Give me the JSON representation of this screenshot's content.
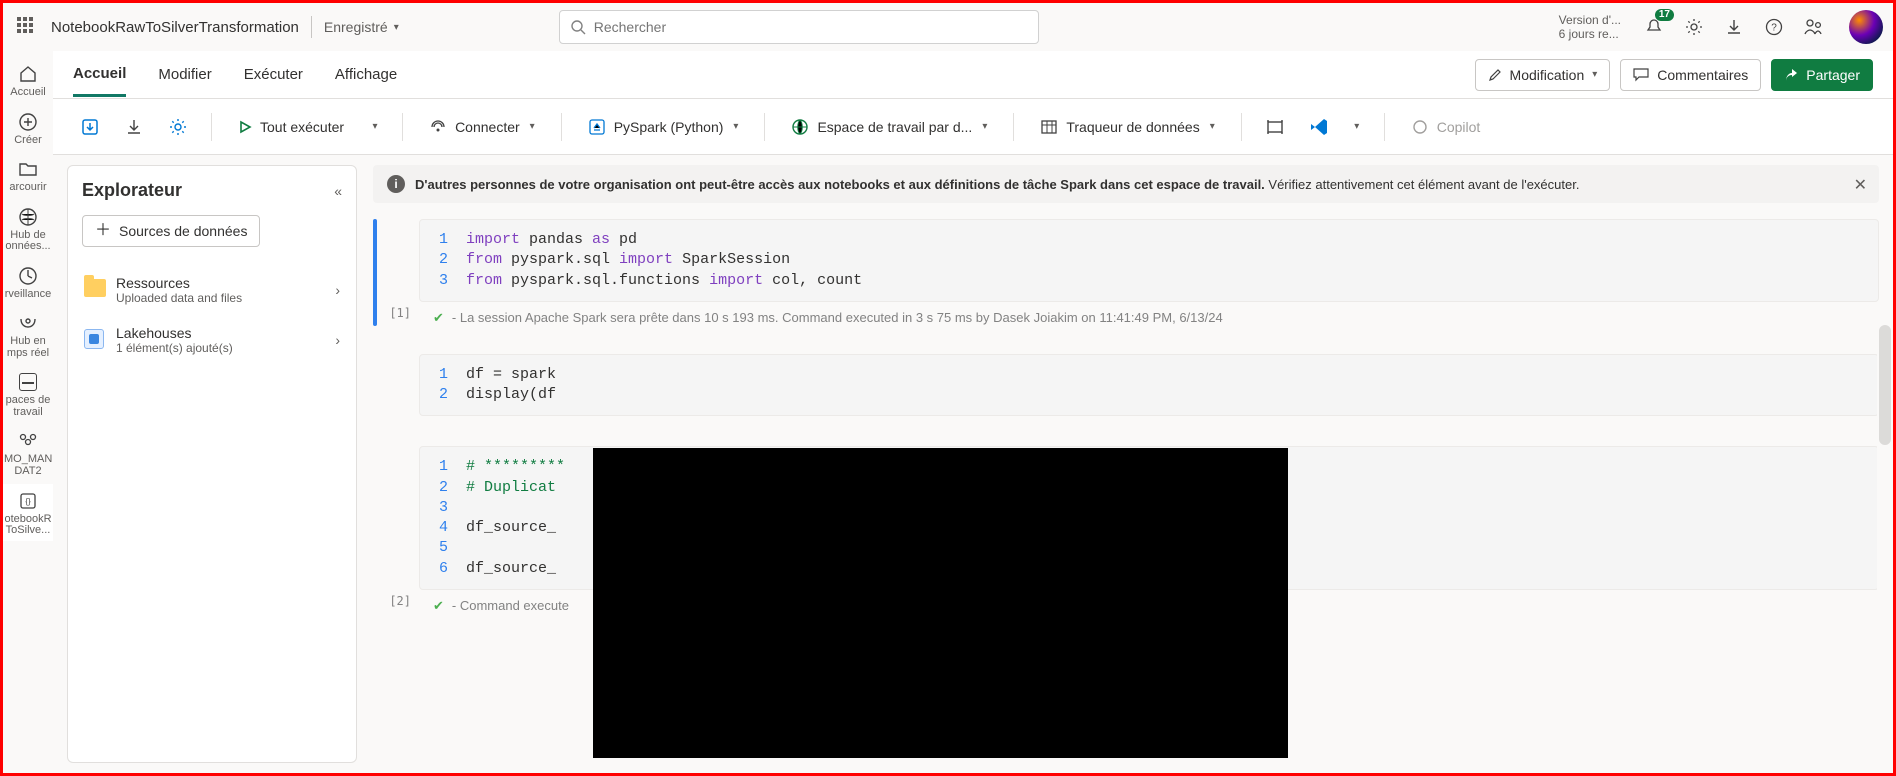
{
  "topbar": {
    "doc_title": "NotebookRawToSilverTransformation",
    "saved_label": "Enregistré",
    "search_placeholder": "Rechercher",
    "version_line1": "Version d'...",
    "version_line2": "6 jours re...",
    "notif_count": "17"
  },
  "tabs": {
    "items": [
      "Accueil",
      "Modifier",
      "Exécuter",
      "Affichage"
    ],
    "edit_btn": "Modification",
    "comments_btn": "Commentaires",
    "share_btn": "Partager"
  },
  "toolbar": {
    "run_all": "Tout exécuter",
    "connect": "Connecter",
    "pyspark": "PySpark (Python)",
    "workspace_default": "Espace de travail par d...",
    "data_tracker": "Traqueur de données",
    "copilot": "Copilot"
  },
  "rail": {
    "items": [
      {
        "label": "Accueil"
      },
      {
        "label": "Créer"
      },
      {
        "label": "arcourir"
      },
      {
        "label": "Hub de onnées..."
      },
      {
        "label": "rveillance"
      },
      {
        "label": "Hub en mps réel"
      },
      {
        "label": "paces de travail"
      },
      {
        "label": "MO_MAN DAT2"
      },
      {
        "label": "otebookR ToSilve..."
      }
    ]
  },
  "explorer": {
    "title": "Explorateur",
    "data_sources_btn": "Sources de données",
    "items": [
      {
        "title": "Ressources",
        "sub": "Uploaded data and files"
      },
      {
        "title": "Lakehouses",
        "sub": "1 élément(s) ajouté(s)"
      }
    ]
  },
  "banner": {
    "bold": "D'autres personnes de votre organisation ont peut-être accès aux notebooks et aux définitions de tâche Spark dans cet espace de travail.",
    "rest": " Vérifiez attentivement cet élément avant de l'exécuter."
  },
  "cells": {
    "c1": {
      "exec": "[1]",
      "lines": [
        {
          "n": "1",
          "html": "<span class='kw'>import</span> pandas <span class='kw'>as</span> pd"
        },
        {
          "n": "2",
          "html": "<span class='kw'>from</span> pyspark.sql <span class='kw'>import</span> SparkSession"
        },
        {
          "n": "3",
          "html": "<span class='kw'>from</span> pyspark.sql.functions <span class='kw'>import</span> col, count"
        }
      ],
      "status": "- La session Apache Spark sera prête dans 10 s 193 ms. Command executed in 3 s 75 ms by Dasek Joiakim on 11:41:49 PM, 6/13/24"
    },
    "c2": {
      "lines": [
        {
          "n": "1",
          "html": "df = spark"
        },
        {
          "n": "2",
          "html": "display(df"
        }
      ]
    },
    "c3": {
      "exec": "[2]",
      "lines": [
        {
          "n": "1",
          "html": "<span style='color:#107c41'># *********</span>"
        },
        {
          "n": "2",
          "html": "<span style='color:#107c41'># Duplicat</span>"
        },
        {
          "n": "3",
          "html": ""
        },
        {
          "n": "4",
          "html": "df_source_"
        },
        {
          "n": "5",
          "html": ""
        },
        {
          "n": "6",
          "html": "df_source_"
        }
      ],
      "status": "- Command execute"
    }
  }
}
